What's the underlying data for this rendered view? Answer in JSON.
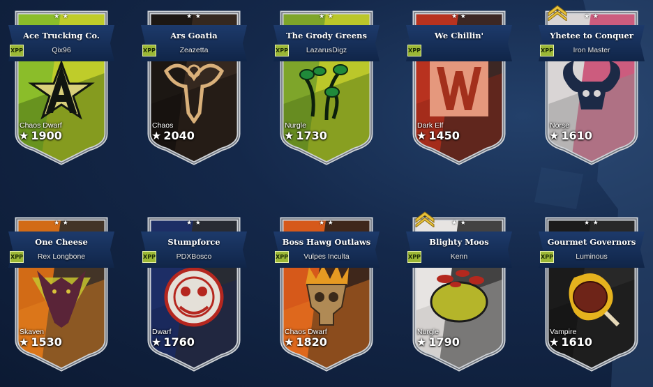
{
  "teams": [
    {
      "name": "Ace Trucking Co.",
      "coach": "Qix96",
      "race": "Chaos Dwarf",
      "rating": "1900",
      "xpp": "XPP",
      "chevron": false,
      "colors": [
        "#8bbd2a",
        "#c8cf2a",
        "#3d5f12"
      ],
      "emblem": "star-a-icon",
      "emblem_color": "#101510",
      "accent": "#d8d07a"
    },
    {
      "name": "Ars Goatia",
      "coach": "Zeazetta",
      "race": "Chaos",
      "rating": "2040",
      "xpp": "XPP",
      "chevron": false,
      "colors": [
        "#1c1713",
        "#3a2c22",
        "#120e0b"
      ],
      "emblem": "goat-skull-icon",
      "emblem_color": "#d9b07a",
      "accent": "#7a2d1e"
    },
    {
      "name": "The Grody Greens",
      "coach": "LazarusDigz",
      "race": "Nurgle",
      "rating": "1730",
      "xpp": "XPP",
      "chevron": false,
      "colors": [
        "#7ea52a",
        "#c5cc2a",
        "#4b6f16"
      ],
      "emblem": "eye-stalks-icon",
      "emblem_color": "#1f8a3a",
      "accent": "#0c1f0c"
    },
    {
      "name": "We Chillin'",
      "coach": "",
      "race": "Dark Elf",
      "rating": "1450",
      "xpp": "XPP",
      "chevron": false,
      "colors": [
        "#b8321f",
        "#262626",
        "#8b2516"
      ],
      "emblem": "letter-w-icon",
      "emblem_color": "#e5987d",
      "accent": "#a3301c"
    },
    {
      "name": "Yhetee to Conquer",
      "coach": "Iron Master",
      "race": "Norse",
      "rating": "1610",
      "xpp": "XPP",
      "chevron": true,
      "colors": [
        "#d9d5d5",
        "#c9466e",
        "#8b8b8b"
      ],
      "emblem": "horned-skull-icon",
      "emblem_color": "#1c2a46",
      "accent": "#cf4a70"
    },
    {
      "name": "One Cheese",
      "coach": "Rex Longbone",
      "race": "Skaven",
      "rating": "1530",
      "xpp": "XPP",
      "chevron": false,
      "colors": [
        "#d26b16",
        "#2a2a2a",
        "#e7861f"
      ],
      "emblem": "rat-triangle-icon",
      "emblem_color": "#5a2438",
      "accent": "#c6c42f"
    },
    {
      "name": "Stumpforce",
      "coach": "PDXBosco",
      "race": "Dwarf",
      "rating": "1760",
      "xpp": "XPP",
      "chevron": false,
      "colors": [
        "#1d2e66",
        "#2a2a2a",
        "#182450"
      ],
      "emblem": "dwarf-mask-icon",
      "emblem_color": "#e4e0d8",
      "accent": "#b5271f"
    },
    {
      "name": "Boss Hawg Outlaws",
      "coach": "Vulpes Inculta",
      "race": "Chaos Dwarf",
      "rating": "1820",
      "xpp": "XPP",
      "chevron": false,
      "colors": [
        "#d6591a",
        "#241f1c",
        "#e97a22"
      ],
      "emblem": "crowned-skull-icon",
      "emblem_color": "#e79a22",
      "accent": "#3b2a1a"
    },
    {
      "name": "Blighty Moos",
      "coach": "Kenn",
      "race": "Nurgle",
      "rating": "1790",
      "xpp": "XPP",
      "chevron": true,
      "colors": [
        "#e7e4e2",
        "#262626",
        "#bdbbb8"
      ],
      "emblem": "mushroom-pig-icon",
      "emblem_color": "#b5b52a",
      "accent": "#b4281e"
    },
    {
      "name": "Gourmet Governors",
      "coach": "Luminous",
      "race": "Vampire",
      "rating": "1610",
      "xpp": "XPP",
      "chevron": false,
      "colors": [
        "#1b1b1b",
        "#2a2a2a",
        "#121212"
      ],
      "emblem": "flaming-meat-icon",
      "emblem_color": "#e5b21e",
      "accent": "#8a3a2d"
    }
  ],
  "icons": {
    "rating_star": "★",
    "banner_stars": "★ ★"
  }
}
